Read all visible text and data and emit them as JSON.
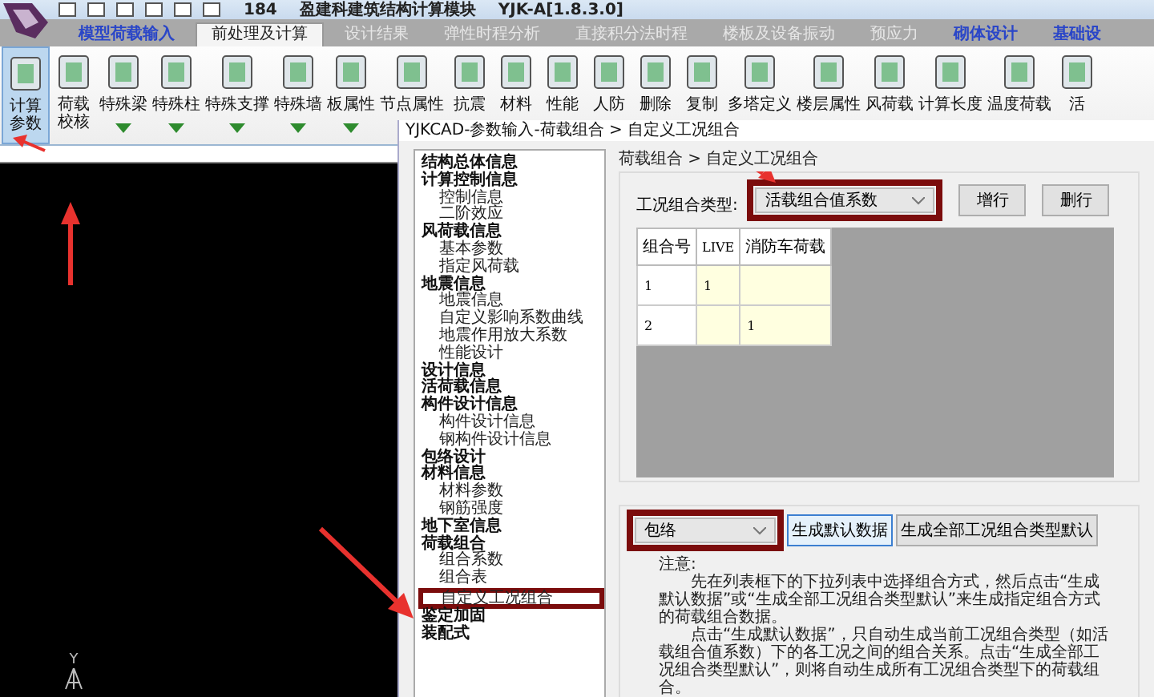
{
  "title_bar": {
    "texts": [
      "184",
      "盈建科建筑结构计算模块",
      "YJK-A[1.8.3.0]"
    ]
  },
  "ribbon_tabs": [
    {
      "label": "模型荷载输入",
      "selected": false,
      "highlighted": true
    },
    {
      "label": "前处理及计算",
      "selected": true,
      "highlighted": false
    },
    {
      "label": "设计结果",
      "selected": false,
      "highlighted": false
    },
    {
      "label": "弹性时程分析",
      "selected": false,
      "highlighted": false
    },
    {
      "label": "直接积分法时程",
      "selected": false,
      "highlighted": false
    },
    {
      "label": "楼板及设备振动",
      "selected": false,
      "highlighted": false
    },
    {
      "label": "预应力",
      "selected": false,
      "highlighted": false
    },
    {
      "label": "砌体设计",
      "selected": false,
      "highlighted": true
    },
    {
      "label": "基础设",
      "selected": false,
      "highlighted": true
    }
  ],
  "ribbon_buttons": [
    {
      "label_lines": [
        "计算",
        "参数"
      ],
      "selected": true
    },
    {
      "label_lines": [
        "荷载",
        "校核"
      ],
      "selected": false
    },
    {
      "label_lines": [
        "特殊梁"
      ],
      "selected": false,
      "dropdown": true
    },
    {
      "label_lines": [
        "特殊柱"
      ],
      "selected": false,
      "dropdown": true
    },
    {
      "label_lines": [
        "特殊支撑"
      ],
      "selected": false,
      "dropdown": true
    },
    {
      "label_lines": [
        "特殊墙"
      ],
      "selected": false,
      "dropdown": true
    },
    {
      "label_lines": [
        "板属性"
      ],
      "selected": false,
      "dropdown": true
    },
    {
      "label_lines": [
        "节点属性"
      ],
      "selected": false
    },
    {
      "label_lines": [
        "抗震"
      ],
      "selected": false
    },
    {
      "label_lines": [
        "材料"
      ],
      "selected": false
    },
    {
      "label_lines": [
        "性能"
      ],
      "selected": false
    },
    {
      "label_lines": [
        "人防"
      ],
      "selected": false
    },
    {
      "label_lines": [
        "删除"
      ],
      "selected": false
    },
    {
      "label_lines": [
        "复制"
      ],
      "selected": false
    },
    {
      "label_lines": [
        "多塔定义"
      ],
      "selected": false
    },
    {
      "label_lines": [
        "楼层属性"
      ],
      "selected": false
    },
    {
      "label_lines": [
        "风荷载"
      ],
      "selected": false
    },
    {
      "label_lines": [
        "计算长度"
      ],
      "selected": false
    },
    {
      "label_lines": [
        "温度荷载"
      ],
      "selected": false
    },
    {
      "label_lines": [
        "活"
      ],
      "selected": false
    }
  ],
  "canvas": {
    "axis_label": "Y"
  },
  "dialog": {
    "title": "YJKCAD-参数输入-荷载组合 > 自定义工况组合",
    "tree": [
      {
        "label": "结构总体信息",
        "selected": false
      },
      {
        "label": "计算控制信息",
        "selected": false,
        "children": [
          {
            "label": "控制信息",
            "selected": false
          },
          {
            "label": "二阶效应",
            "selected": false
          }
        ]
      },
      {
        "label": "风荷载信息",
        "selected": false,
        "children": [
          {
            "label": "基本参数",
            "selected": false
          },
          {
            "label": "指定风荷载",
            "selected": false
          }
        ]
      },
      {
        "label": "地震信息",
        "selected": false,
        "children": [
          {
            "label": "地震信息",
            "selected": false
          },
          {
            "label": "自定义影响系数曲线",
            "selected": false
          },
          {
            "label": "地震作用放大系数",
            "selected": false
          },
          {
            "label": "性能设计",
            "selected": false
          }
        ]
      },
      {
        "label": "设计信息",
        "selected": false
      },
      {
        "label": "活荷载信息",
        "selected": false
      },
      {
        "label": "构件设计信息",
        "selected": false,
        "children": [
          {
            "label": "构件设计信息",
            "selected": false
          },
          {
            "label": "钢构件设计信息",
            "selected": false
          }
        ]
      },
      {
        "label": "包络设计",
        "selected": false
      },
      {
        "label": "材料信息",
        "selected": false,
        "children": [
          {
            "label": "材料参数",
            "selected": false
          },
          {
            "label": "钢筋强度",
            "selected": false
          }
        ]
      },
      {
        "label": "地下室信息",
        "selected": false
      },
      {
        "label": "荷载组合",
        "selected": false,
        "children": [
          {
            "label": "组合系数",
            "selected": false
          },
          {
            "label": "组合表",
            "selected": false
          },
          {
            "label": "自定义工况组合",
            "selected": true
          }
        ]
      },
      {
        "label": "鉴定加固",
        "selected": false
      },
      {
        "label": "装配式",
        "selected": false
      }
    ],
    "breadcrumb": "荷载组合 > 自定义工况组合",
    "combo_type_label": "工况组合类型:",
    "combo_type_select": "活载组合值系数",
    "buttons": [
      "增行",
      "删行"
    ],
    "table": {
      "columns": [
        "组合号",
        "LIVE",
        "消防车荷载"
      ],
      "rows": [
        [
          "1",
          "1",
          ""
        ],
        [
          "2",
          "",
          "1"
        ]
      ]
    },
    "method_select": "包络",
    "generate_buttons": [
      {
        "label": "生成默认数据",
        "focused": true
      },
      {
        "label": "生成全部工况组合类型默认",
        "focused": false
      }
    ],
    "note_title": "注意:",
    "note_paragraphs": [
      "先在列表框下的下拉列表中选择组合方式，然后点击“生成默认数据”或“生成全部工况组合类型默认”来生成指定组合方式的荷载组合数据。",
      "点击“生成默认数据”，只自动生成当前工况组合类型（如活载组合值系数）下的各工况之间的组合关系。点击“生成全部工况组合类型默认”，则将自动生成所有工况组合类型下的荷载组合。"
    ]
  }
}
